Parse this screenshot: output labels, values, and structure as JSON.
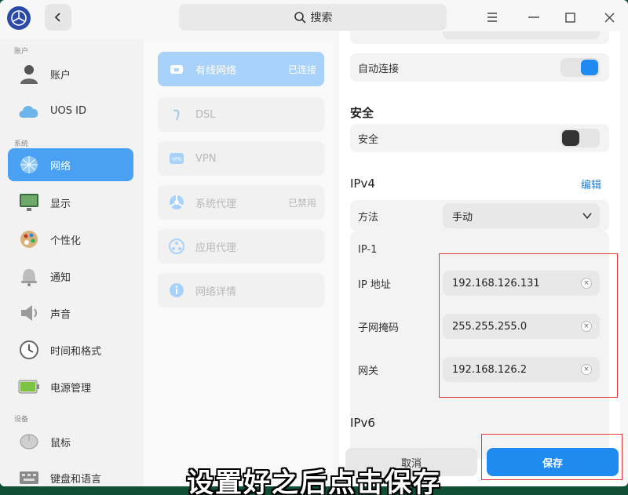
{
  "search": {
    "label": "搜索"
  },
  "sidebar": {
    "groups": {
      "account": "账户",
      "system": "系统",
      "device": "设备"
    },
    "items": [
      {
        "label": "账户"
      },
      {
        "label": "UOS ID"
      },
      {
        "label": "网络"
      },
      {
        "label": "显示"
      },
      {
        "label": "个性化"
      },
      {
        "label": "通知"
      },
      {
        "label": "声音"
      },
      {
        "label": "时间和格式"
      },
      {
        "label": "电源管理"
      },
      {
        "label": "鼠标"
      },
      {
        "label": "键盘和语言"
      }
    ]
  },
  "network_menu": {
    "items": [
      {
        "label": "有线网络",
        "status": "已连接"
      },
      {
        "label": "DSL",
        "status": ""
      },
      {
        "label": "VPN",
        "status": ""
      },
      {
        "label": "系统代理",
        "status": "已禁用"
      },
      {
        "label": "应用代理",
        "status": ""
      },
      {
        "label": "网络详情",
        "status": ""
      }
    ]
  },
  "content": {
    "auto_connect": {
      "label": "自动连接",
      "on": true
    },
    "security_section": {
      "title": "安全",
      "label": "安全",
      "on": false
    },
    "ipv4": {
      "title": "IPv4",
      "edit": "编辑",
      "method_label": "方法",
      "method_value": "手动",
      "ip_group": "IP-1",
      "ip_label": "IP 地址",
      "ip_value": "192.168.126.131",
      "mask_label": "子网掩码",
      "mask_value": "255.255.255.0",
      "gateway_label": "网关",
      "gateway_value": "192.168.126.2"
    },
    "ipv6": {
      "title": "IPv6"
    }
  },
  "buttons": {
    "cancel": "取消",
    "save": "保存"
  },
  "caption": "设置好之后点击保存",
  "colors": {
    "accent": "#1f8bf0",
    "highlight_box": "#e23a3a",
    "toggle_on": "#1f8bf0",
    "toggle_off_knob": "#333333"
  }
}
